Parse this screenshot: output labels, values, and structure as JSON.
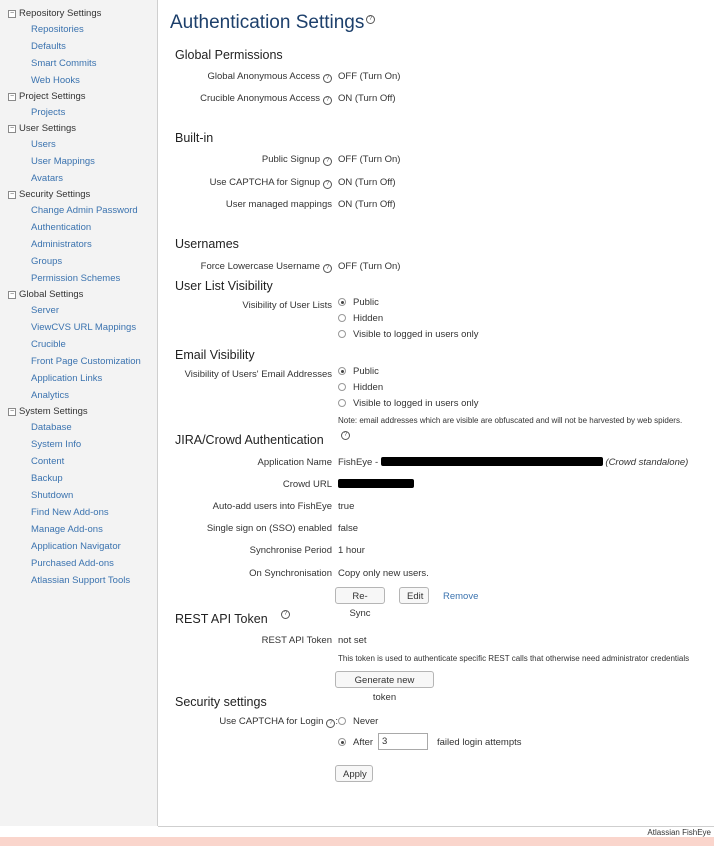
{
  "sidebar": {
    "repository": {
      "title": "Repository Settings",
      "items": [
        "Repositories",
        "Defaults",
        "Smart Commits",
        "Web Hooks"
      ]
    },
    "project": {
      "title": "Project Settings",
      "items": [
        "Projects"
      ]
    },
    "user": {
      "title": "User Settings",
      "items": [
        "Users",
        "User Mappings",
        "Avatars"
      ]
    },
    "security": {
      "title": "Security Settings",
      "items": [
        "Change Admin Password",
        "Authentication",
        "Administrators",
        "Groups",
        "Permission Schemes"
      ]
    },
    "global": {
      "title": "Global Settings",
      "items": [
        "Server",
        "ViewCVS URL Mappings",
        "Crucible",
        "Front Page Customization",
        "Application Links",
        "Analytics"
      ]
    },
    "system": {
      "title": "System Settings",
      "items": [
        "Database",
        "System Info",
        "Content",
        "Backup",
        "Shutdown",
        "Find New Add-ons",
        "Manage Add-ons",
        "Application Navigator",
        "Purchased Add-ons",
        "Atlassian Support Tools"
      ]
    },
    "toggle_glyph": "−"
  },
  "page": {
    "title": "Authentication Settings",
    "help_glyph": "?"
  },
  "global_permissions": {
    "heading": "Global Permissions",
    "rows": [
      {
        "label": "Global Anonymous Access",
        "value": "OFF (Turn On)"
      },
      {
        "label": "Crucible Anonymous Access",
        "value": "ON (Turn Off)"
      }
    ]
  },
  "builtin": {
    "heading": "Built-in",
    "rows": [
      {
        "label": "Public Signup",
        "value": "OFF (Turn On)"
      },
      {
        "label": "Use CAPTCHA for Signup",
        "value": "ON (Turn Off)"
      },
      {
        "label": "User managed mappings",
        "value": "ON (Turn Off)"
      }
    ]
  },
  "usernames": {
    "heading": "Usernames",
    "label": "Force Lowercase Username",
    "value": "OFF (Turn On)"
  },
  "user_list_visibility": {
    "heading": "User List Visibility",
    "label": "Visibility of User Lists",
    "options": [
      "Public",
      "Hidden",
      "Visible to logged in users only"
    ],
    "selected": "Public"
  },
  "email_visibility": {
    "heading": "Email Visibility",
    "label": "Visibility of Users' Email Addresses",
    "options": [
      "Public",
      "Hidden",
      "Visible to logged in users only"
    ],
    "selected": "Public",
    "note": "Note: email addresses which are visible are obfuscated and will not be harvested by web spiders."
  },
  "jira_crowd": {
    "heading": "JIRA/Crowd Authentication",
    "application_name_label": "Application Name",
    "application_name_prefix": "FishEye -",
    "application_name_suffix": "(Crowd standalone)",
    "crowd_url_label": "Crowd URL",
    "auto_add_label": "Auto-add users into FishEye",
    "auto_add_value": "true",
    "sso_label": "Single sign on (SSO) enabled",
    "sso_value": "false",
    "sync_period_label": "Synchronise Period",
    "sync_period_value": "1 hour",
    "on_sync_label": "On Synchronisation",
    "on_sync_value": "Copy only new users.",
    "resync_button": "Re-Sync",
    "edit_button": "Edit",
    "remove_link": "Remove"
  },
  "rest_api": {
    "heading": "REST API Token",
    "label": "REST API Token",
    "value": "not set",
    "note": "This token is used to authenticate specific REST calls that otherwise need administrator credentials",
    "generate_button": "Generate new token"
  },
  "security_settings": {
    "heading": "Security settings",
    "captcha_label": "Use CAPTCHA for Login",
    "captcha_colon": ":",
    "never_label": "Never",
    "after_label": "After",
    "selected": "After",
    "attempts_value": "3",
    "attempts_suffix": "failed login attempts",
    "apply_button": "Apply"
  },
  "footer": {
    "text": "Atlassian FishEye"
  },
  "colors": {
    "link": "#3b73af",
    "title": "#1c3f6b",
    "sidebar_bg": "#f3f3f3",
    "bottom_strip": "#fad5cc"
  }
}
